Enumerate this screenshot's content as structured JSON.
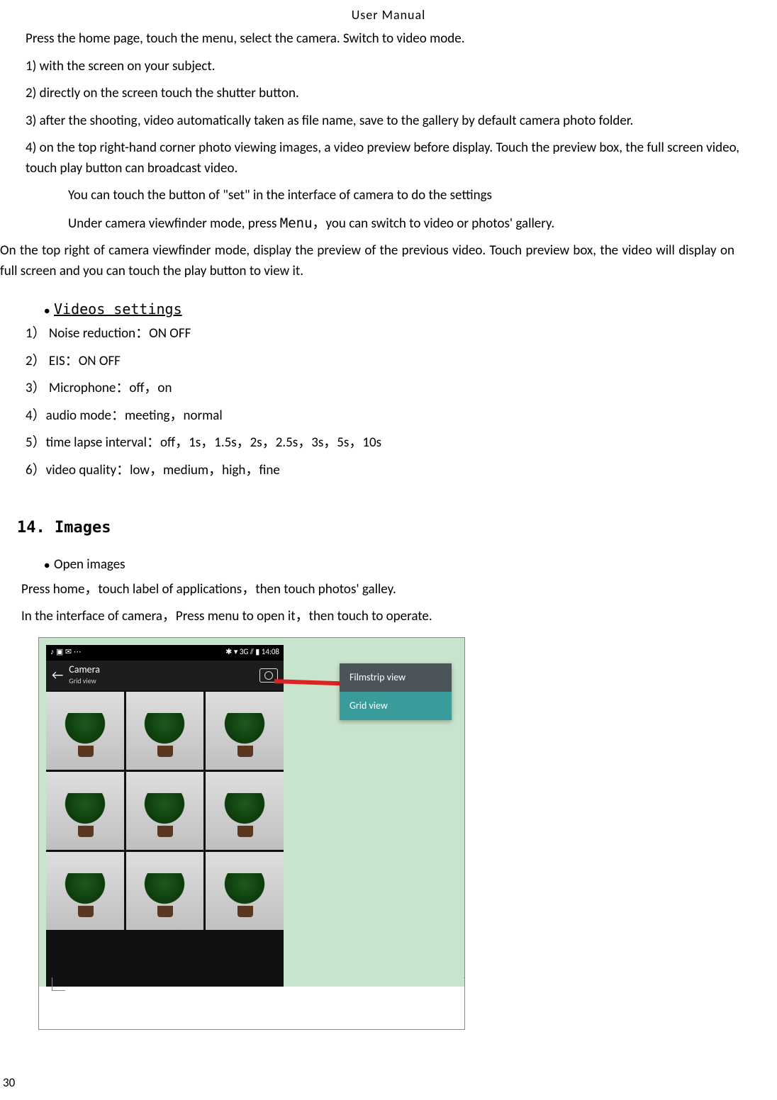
{
  "header": "User    Manual",
  "body": {
    "p1": "Press the home page, touch the menu, select the camera. Switch to video mode.",
    "p2": "1) with the screen on your subject.",
    "p3": "2) directly on the screen touch the shutter button.",
    "p4": "3) after the shooting, video automatically taken as file name, save to the gallery by default camera photo folder.",
    "p5": "4) on the top right-hand corner photo viewing images, a video preview before display. Touch the preview box, the full screen video, touch play button can broadcast video.",
    "p6": "You can touch the button of \"set\" in the interface of camera to do the settings",
    "p7a": "Under camera viewfinder mode, press ",
    "p7b": "Menu",
    "p7c": "，you can switch to video or photos' gallery.",
    "p8": "On the top right of camera viewfinder mode, display the preview of the previous video. Touch preview box, the video will display on full screen and you can touch the play button to view it.",
    "videos_heading": "Videos settings",
    "v1": "1） Noise reduction：ON OFF",
    "v2": "2） EIS：ON      OFF",
    "v3": "3） Microphone：off，on",
    "v4": "4）audio mode：meeting，normal",
    "v5": "5）time lapse interval：off，1s，1.5s，2s，2.5s，3s，5s，10s",
    "v6": "6）video quality：low，medium，high，fine",
    "section_title": "14. Images",
    "open_images": "Open images",
    "oi1": "Press home，touch label of applications，then touch photos' galley.",
    "oi2": "In the interface of camera，Press menu to open it，then touch to operate."
  },
  "figure": {
    "status_left": "♪ ▣ ✉ ⋯",
    "status_right": "✱ ▾ 3G ⫽ ▮ 14:08",
    "back": "←",
    "title": "Camera",
    "subtitle": "Grid view",
    "menu1": "Filmstrip view",
    "menu2": "Grid view"
  },
  "page_number": "30"
}
